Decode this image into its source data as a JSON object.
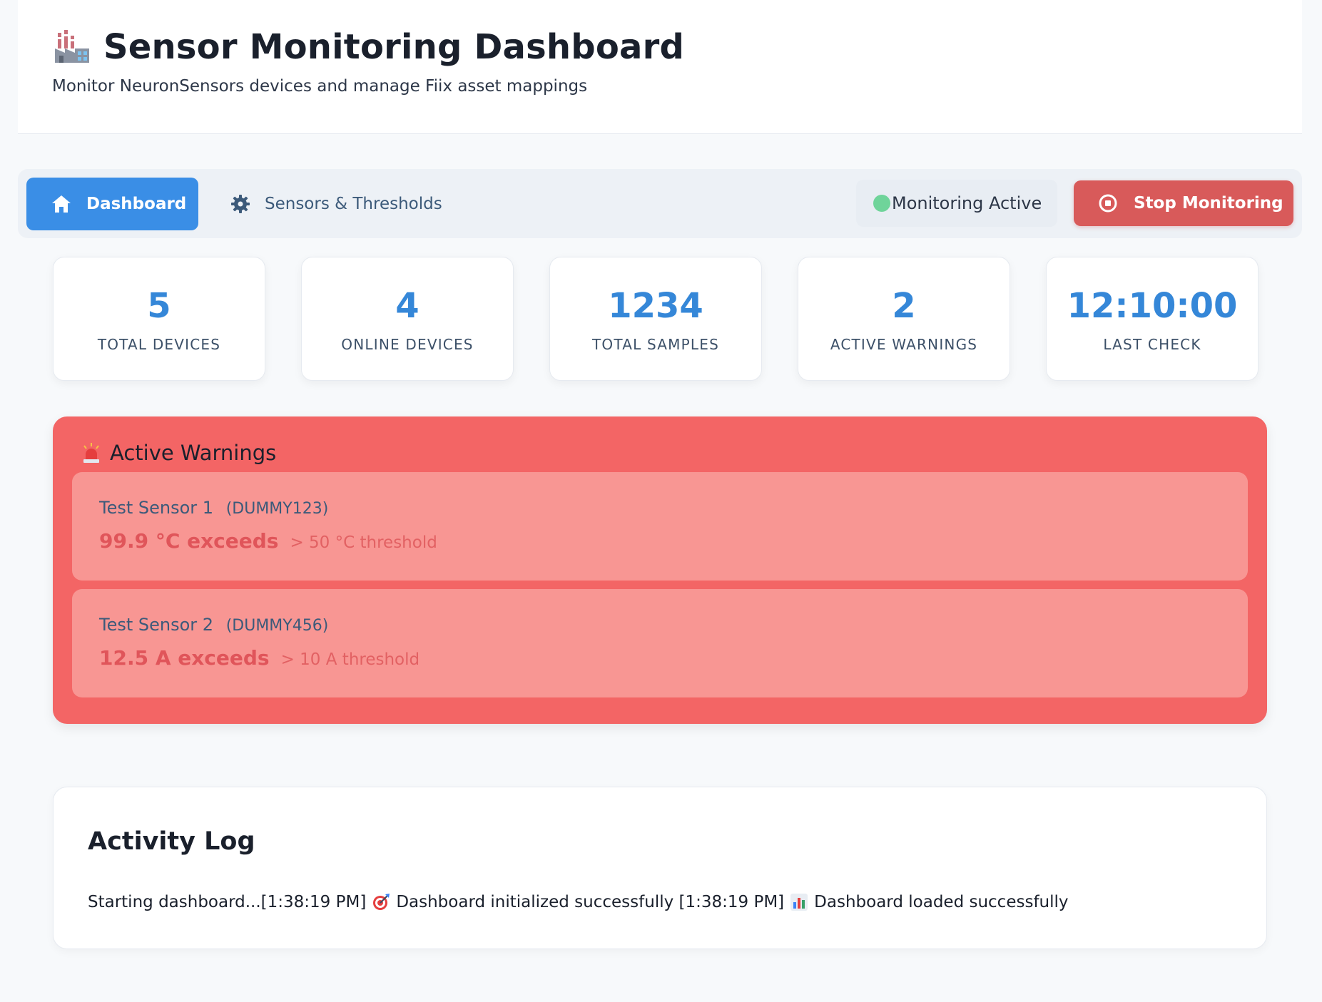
{
  "header": {
    "title": "Sensor Monitoring Dashboard",
    "subtitle": "Monitor NeuronSensors devices and manage Fiix asset mappings",
    "icon": "factory-icon"
  },
  "nav": {
    "tabs": [
      {
        "label": "Dashboard",
        "icon": "home-icon",
        "active": true
      },
      {
        "label": "Sensors & Thresholds",
        "icon": "gear-icon",
        "active": false
      }
    ],
    "status_label": "Monitoring Active",
    "stop_label": "Stop Monitoring"
  },
  "stats": [
    {
      "value": "5",
      "label": "TOTAL DEVICES"
    },
    {
      "value": "4",
      "label": "ONLINE DEVICES"
    },
    {
      "value": "1234",
      "label": "TOTAL SAMPLES"
    },
    {
      "value": "2",
      "label": "ACTIVE WARNINGS"
    },
    {
      "value": "12:10:00",
      "label": "LAST CHECK"
    }
  ],
  "warnings": {
    "title": "Active Warnings",
    "items": [
      {
        "sensor": "Test Sensor 1",
        "id": "(DUMMY123)",
        "value": "99.9 °C exceeds",
        "threshold": "> 50 °C threshold"
      },
      {
        "sensor": "Test Sensor 2",
        "id": "(DUMMY456)",
        "value": "12.5 A exceeds",
        "threshold": "> 10 A threshold"
      }
    ]
  },
  "activity_log": {
    "title": "Activity Log",
    "line_start": "Starting dashboard...[1:38:19 PM]",
    "entry_1": "Dashboard initialized successfully [1:38:19 PM]",
    "entry_2": "Dashboard loaded successfully"
  },
  "colors": {
    "primary": "#3a8ee6",
    "danger": "#d85a5a",
    "warning_panel": "#f36565",
    "warning_item": "#f89693",
    "status_ok": "#6fd49a",
    "stat_value": "#3587d8"
  }
}
